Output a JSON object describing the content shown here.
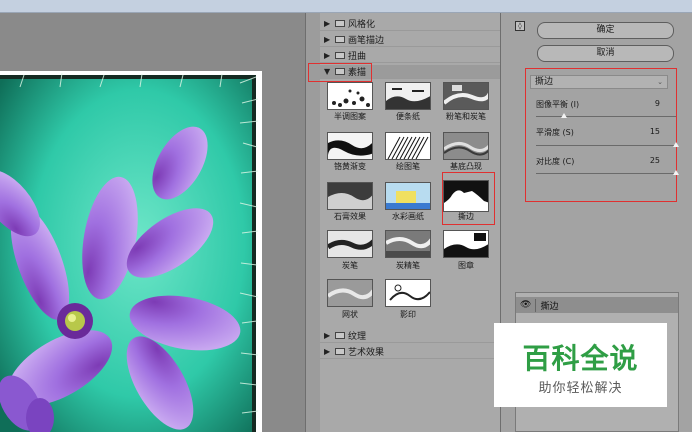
{
  "gallery": {
    "categories_top": [
      {
        "label": "风格化",
        "expanded": false
      },
      {
        "label": "画笔描边",
        "expanded": false
      },
      {
        "label": "扭曲",
        "expanded": false
      },
      {
        "label": "素描",
        "expanded": true
      }
    ],
    "thumbnails": [
      {
        "label": "半调图案"
      },
      {
        "label": "便条纸"
      },
      {
        "label": "粉笔和炭笔"
      },
      {
        "label": "铬黄渐变"
      },
      {
        "label": "绘图笔"
      },
      {
        "label": "基底凸现"
      },
      {
        "label": "石膏效果"
      },
      {
        "label": "水彩画纸"
      },
      {
        "label": "撕边",
        "selected": true
      },
      {
        "label": "炭笔"
      },
      {
        "label": "炭精笔"
      },
      {
        "label": "图章"
      },
      {
        "label": "网状"
      },
      {
        "label": "影印"
      }
    ],
    "categories_bottom": [
      {
        "label": "纹理",
        "expanded": false
      },
      {
        "label": "艺术效果",
        "expanded": false
      }
    ]
  },
  "panel": {
    "collapse_icon": "◊",
    "ok_label": "确定",
    "cancel_label": "取消",
    "filter_select": "撕边",
    "params": [
      {
        "label": "图像平衡 (I)",
        "value": "9",
        "fraction": 0.18
      },
      {
        "label": "平滑度 (S)",
        "value": "15",
        "fraction": 1.0
      },
      {
        "label": "对比度 (C)",
        "value": "25",
        "fraction": 1.0
      }
    ],
    "layer_label": "撕边"
  },
  "watermark": {
    "title": "百科全说",
    "subtitle": "助你轻松解决"
  },
  "colors": {
    "highlight": "#e03030",
    "watermark_green": "#2f9e45",
    "photo_teal": "#2fc9a8",
    "flower_purple": "#a070e0"
  }
}
